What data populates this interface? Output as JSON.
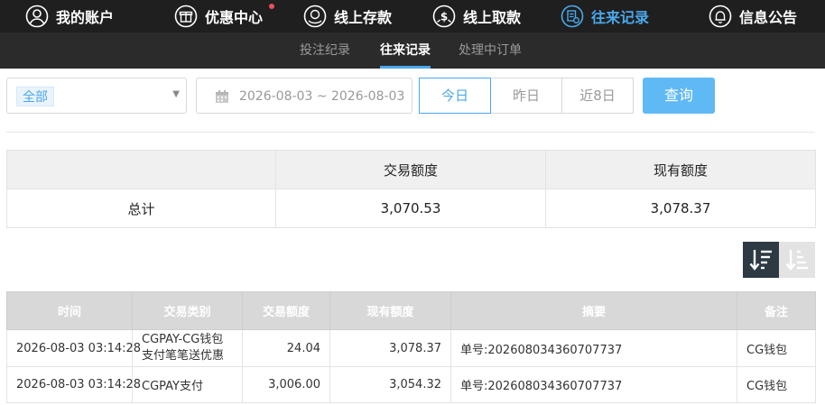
{
  "topnav": {
    "items": [
      {
        "label": "我的账户",
        "icon": "user-icon"
      },
      {
        "label": "优惠中心",
        "icon": "gift-icon"
      },
      {
        "label": "线上存款",
        "icon": "deposit-icon"
      },
      {
        "label": "线上取款",
        "icon": "withdraw-icon"
      },
      {
        "label": "往来记录",
        "icon": "records-icon"
      },
      {
        "label": "信息公告",
        "icon": "bell-icon"
      }
    ],
    "active": "往来记录",
    "accent": "#4aa8ec",
    "notice_dot_color": "#e8505b"
  },
  "subnav": {
    "items": [
      "投注纪录",
      "往来记录",
      "处理中订单"
    ],
    "active": "往来记录"
  },
  "filters": {
    "type_selected": "全部",
    "date_range": "2026-08-03 ~ 2026-08-03",
    "quick_ranges": [
      "今日",
      "昨日",
      "近8日"
    ],
    "quick_active": "今日",
    "query_label": "查询",
    "query_color": "#5fb9f5"
  },
  "summary": {
    "headers": [
      "",
      "交易额度",
      "现有额度"
    ],
    "row_label": "总计",
    "trade_amount": "3,070.53",
    "current_balance": "3,078.37"
  },
  "sort": {
    "desc_icon": "sort-descending-icon",
    "asc_icon": "sort-ascending-icon"
  },
  "records": {
    "headers": [
      "时间",
      "交易类别",
      "交易额度",
      "现有额度",
      "摘要",
      "备注"
    ],
    "rows": [
      [
        "2026-08-03 03:14:28",
        "CGPAY-CG钱包支付笔笔送优惠",
        "24.04",
        "3,078.37",
        "单号:202608034360707737",
        "CG钱包"
      ],
      [
        "2026-08-03 03:14:28",
        "CGPAY支付",
        "3,006.00",
        "3,054.32",
        "单号:202608034360707737",
        "CG钱包"
      ]
    ]
  }
}
